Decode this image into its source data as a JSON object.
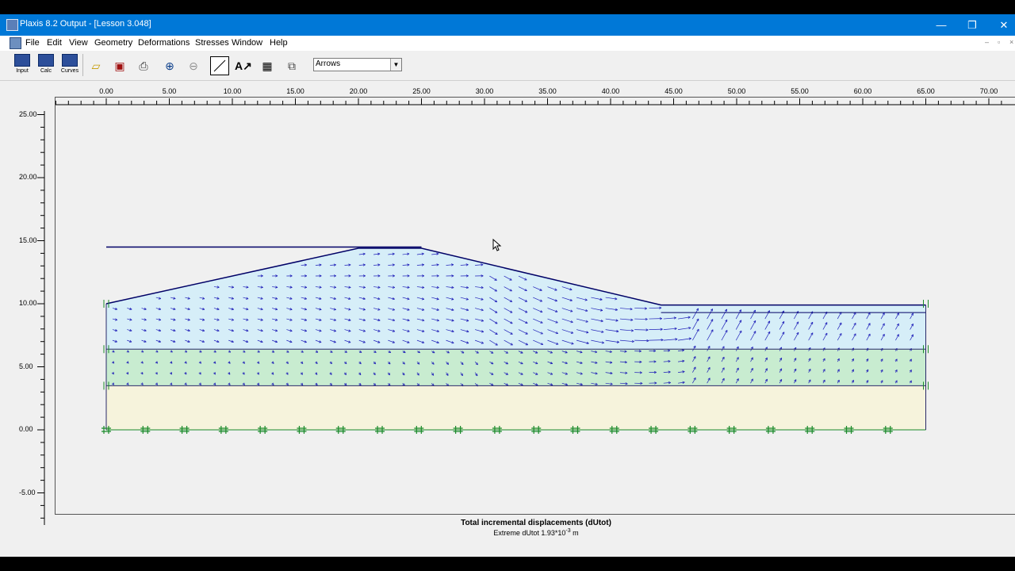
{
  "window": {
    "title": "Plaxis 8.2 Output - [Lesson 3.048]",
    "controls": {
      "minimize": "—",
      "restore": "❐",
      "close": "✕"
    }
  },
  "menu": {
    "items": [
      "File",
      "Edit",
      "View",
      "Geometry",
      "Deformations",
      "Stresses",
      "Window",
      "Help"
    ],
    "mdi_controls": {
      "minimize": "–",
      "restore": "▫",
      "close": "×"
    }
  },
  "toolbar": {
    "input_label": "Input",
    "calc_label": "Calc",
    "curves_label": "Curves",
    "icons": [
      "open-icon",
      "close-file-icon",
      "print-icon",
      "zoom-in-icon",
      "zoom-out-icon",
      "reset-view-icon",
      "annotation-icon",
      "table-icon",
      "scan-line-icon"
    ],
    "display_combo": {
      "value": "Arrows"
    }
  },
  "plot": {
    "x_ticks": [
      "0.00",
      "5.00",
      "10.00",
      "15.00",
      "20.00",
      "25.00",
      "30.00",
      "35.00",
      "40.00",
      "45.00",
      "50.00",
      "55.00",
      "60.00",
      "65.00",
      "70.00"
    ],
    "y_ticks": [
      "25.00",
      "20.00",
      "15.00",
      "10.00",
      "5.00",
      "0.00",
      "-5.00"
    ],
    "x_range": [
      -4.0,
      71.5
    ],
    "y_range": [
      -7.4,
      25.0
    ],
    "embankment_profile": [
      [
        0,
        10.0
      ],
      [
        20,
        14.4
      ],
      [
        25,
        14.4
      ],
      [
        44,
        9.9
      ],
      [
        65,
        9.9
      ]
    ],
    "water_level": [
      [
        0,
        14.5
      ],
      [
        25,
        14.5
      ]
    ],
    "clay_top": 9.3,
    "layer_boundaries": [
      6.4,
      3.5,
      0.0
    ],
    "model_width": [
      0,
      65
    ],
    "colors": {
      "embankment_fill": "#d6eef8",
      "clay_fill": "#c8ecd0",
      "sand_fill": "#f6f3dc",
      "arrow": "#1f1fb8",
      "boundary_fixity": "#1a8a2a",
      "profile_line": "#000066"
    }
  },
  "caption": {
    "title": "Total incremental displacements (dUtot)",
    "subtitle_prefix": "Extreme dUtot 1.93*10",
    "subtitle_exp": "-3",
    "subtitle_unit": "m"
  }
}
